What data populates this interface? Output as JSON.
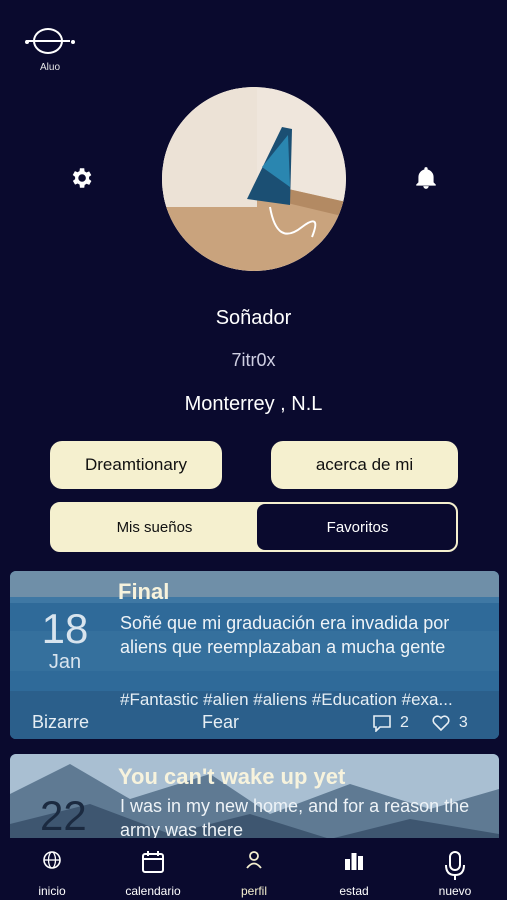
{
  "app": {
    "logo_label": "Aluo"
  },
  "profile": {
    "username": "Soñador",
    "handle": "7itr0x",
    "location": "Monterrey , N.L"
  },
  "buttons": {
    "dreamtionary": "Dreamtionary",
    "about": "acerca de mi"
  },
  "tabs": {
    "mine": "Mis sueños",
    "favorites": "Favoritos",
    "selected": "Favoritos"
  },
  "dreams": [
    {
      "day": "18",
      "month": "Jan",
      "title": "Final",
      "text": "Soñé que mi graduación era invadida por aliens que reemplazaban a mucha gente",
      "tags": "#Fantastic  #alien  #aliens  #Education  #exa...",
      "category": "Bizarre",
      "emotion": "Fear",
      "comments": "2",
      "likes": "3"
    },
    {
      "day": "22",
      "title": "You can't wake up yet",
      "text": "I was in my new home, and for a reason the army was there"
    }
  ],
  "nav": [
    {
      "label": "inicio",
      "icon": "globe-icon"
    },
    {
      "label": "calendario",
      "icon": "calendar-icon"
    },
    {
      "label": "perfil",
      "icon": "person-icon"
    },
    {
      "label": "estad",
      "icon": "bar-chart-icon"
    },
    {
      "label": "nuevo",
      "icon": "microphone-icon"
    }
  ],
  "colors": {
    "background": "#0a0a2e",
    "accent": "#f5f0cf",
    "card": "#2a5f8e"
  }
}
